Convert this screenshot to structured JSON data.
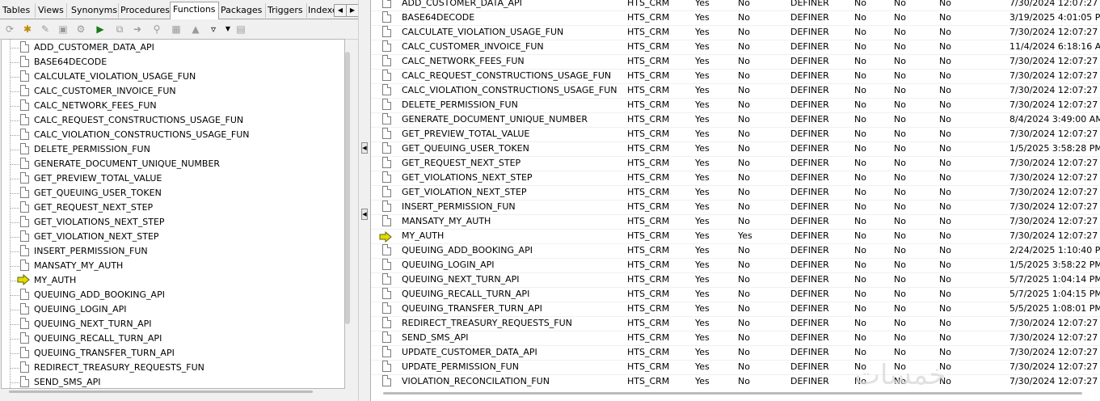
{
  "tabs": {
    "items": [
      "Tables",
      "Views",
      "Synonyms",
      "Procedures",
      "Functions",
      "Packages",
      "Triggers",
      "Indexe"
    ],
    "active": "Functions"
  },
  "toolbar": {
    "icons": [
      "refresh-icon",
      "new-object-icon",
      "edit-icon",
      "save-icon",
      "compile-icon",
      "debug-icon",
      "copy-icon",
      "export-icon",
      "find-icon",
      "chart-icon",
      "filter-icon"
    ]
  },
  "functions": [
    "ADD_CUSTOMER_DATA_API",
    "BASE64DECODE",
    "CALCULATE_VIOLATION_USAGE_FUN",
    "CALC_CUSTOMER_INVOICE_FUN",
    "CALC_NETWORK_FEES_FUN",
    "CALC_REQUEST_CONSTRUCTIONS_USAGE_FUN",
    "CALC_VIOLATION_CONSTRUCTIONS_USAGE_FUN",
    "DELETE_PERMISSION_FUN",
    "GENERATE_DOCUMENT_UNIQUE_NUMBER",
    "GET_PREVIEW_TOTAL_VALUE",
    "GET_QUEUING_USER_TOKEN",
    "GET_REQUEST_NEXT_STEP",
    "GET_VIOLATIONS_NEXT_STEP",
    "GET_VIOLATION_NEXT_STEP",
    "INSERT_PERMISSION_FUN",
    "MANSATY_MY_AUTH",
    "MY_AUTH",
    "QUEUING_ADD_BOOKING_API",
    "QUEUING_LOGIN_API",
    "QUEUING_NEXT_TURN_API",
    "QUEUING_RECALL_TURN_API",
    "QUEUING_TRANSFER_TURN_API",
    "REDIRECT_TREASURY_REQUESTS_FUN",
    "SEND_SMS_API"
  ],
  "selected_function": "MY_AUTH",
  "grid": {
    "rows": [
      {
        "name": "ADD_CUSTOMER_DATA_API",
        "owner": "HTS_CRM",
        "valid": "Yes",
        "debug": "No",
        "authid": "DEFINER",
        "c1": "No",
        "c2": "No",
        "c3": "No",
        "modified": "7/30/2024 12:07:27 P"
      },
      {
        "name": "BASE64DECODE",
        "owner": "HTS_CRM",
        "valid": "Yes",
        "debug": "No",
        "authid": "DEFINER",
        "c1": "No",
        "c2": "No",
        "c3": "No",
        "modified": "3/19/2025 4:01:05 PM"
      },
      {
        "name": "CALCULATE_VIOLATION_USAGE_FUN",
        "owner": "HTS_CRM",
        "valid": "Yes",
        "debug": "No",
        "authid": "DEFINER",
        "c1": "No",
        "c2": "No",
        "c3": "No",
        "modified": "7/30/2024 12:07:27 P"
      },
      {
        "name": "CALC_CUSTOMER_INVOICE_FUN",
        "owner": "HTS_CRM",
        "valid": "Yes",
        "debug": "No",
        "authid": "DEFINER",
        "c1": "No",
        "c2": "No",
        "c3": "No",
        "modified": "11/4/2024 6:18:16 AM"
      },
      {
        "name": "CALC_NETWORK_FEES_FUN",
        "owner": "HTS_CRM",
        "valid": "Yes",
        "debug": "No",
        "authid": "DEFINER",
        "c1": "No",
        "c2": "No",
        "c3": "No",
        "modified": "7/30/2024 12:07:27 P"
      },
      {
        "name": "CALC_REQUEST_CONSTRUCTIONS_USAGE_FUN",
        "owner": "HTS_CRM",
        "valid": "Yes",
        "debug": "No",
        "authid": "DEFINER",
        "c1": "No",
        "c2": "No",
        "c3": "No",
        "modified": "7/30/2024 12:07:27 P"
      },
      {
        "name": "CALC_VIOLATION_CONSTRUCTIONS_USAGE_FUN",
        "owner": "HTS_CRM",
        "valid": "Yes",
        "debug": "No",
        "authid": "DEFINER",
        "c1": "No",
        "c2": "No",
        "c3": "No",
        "modified": "7/30/2024 12:07:27 P"
      },
      {
        "name": "DELETE_PERMISSION_FUN",
        "owner": "HTS_CRM",
        "valid": "Yes",
        "debug": "No",
        "authid": "DEFINER",
        "c1": "No",
        "c2": "No",
        "c3": "No",
        "modified": "7/30/2024 12:07:27 P"
      },
      {
        "name": "GENERATE_DOCUMENT_UNIQUE_NUMBER",
        "owner": "HTS_CRM",
        "valid": "Yes",
        "debug": "No",
        "authid": "DEFINER",
        "c1": "No",
        "c2": "No",
        "c3": "No",
        "modified": "8/4/2024 3:49:00 AM"
      },
      {
        "name": "GET_PREVIEW_TOTAL_VALUE",
        "owner": "HTS_CRM",
        "valid": "Yes",
        "debug": "No",
        "authid": "DEFINER",
        "c1": "No",
        "c2": "No",
        "c3": "No",
        "modified": "7/30/2024 12:07:27 P"
      },
      {
        "name": "GET_QUEUING_USER_TOKEN",
        "owner": "HTS_CRM",
        "valid": "Yes",
        "debug": "No",
        "authid": "DEFINER",
        "c1": "No",
        "c2": "No",
        "c3": "No",
        "modified": "1/5/2025 3:58:28 PM"
      },
      {
        "name": "GET_REQUEST_NEXT_STEP",
        "owner": "HTS_CRM",
        "valid": "Yes",
        "debug": "No",
        "authid": "DEFINER",
        "c1": "No",
        "c2": "No",
        "c3": "No",
        "modified": "7/30/2024 12:07:27 P"
      },
      {
        "name": "GET_VIOLATIONS_NEXT_STEP",
        "owner": "HTS_CRM",
        "valid": "Yes",
        "debug": "No",
        "authid": "DEFINER",
        "c1": "No",
        "c2": "No",
        "c3": "No",
        "modified": "7/30/2024 12:07:27 P"
      },
      {
        "name": "GET_VIOLATION_NEXT_STEP",
        "owner": "HTS_CRM",
        "valid": "Yes",
        "debug": "No",
        "authid": "DEFINER",
        "c1": "No",
        "c2": "No",
        "c3": "No",
        "modified": "7/30/2024 12:07:27 P"
      },
      {
        "name": "INSERT_PERMISSION_FUN",
        "owner": "HTS_CRM",
        "valid": "Yes",
        "debug": "No",
        "authid": "DEFINER",
        "c1": "No",
        "c2": "No",
        "c3": "No",
        "modified": "7/30/2024 12:07:27 P"
      },
      {
        "name": "MANSATY_MY_AUTH",
        "owner": "HTS_CRM",
        "valid": "Yes",
        "debug": "No",
        "authid": "DEFINER",
        "c1": "No",
        "c2": "No",
        "c3": "No",
        "modified": "7/30/2024 12:07:27 P"
      },
      {
        "name": "MY_AUTH",
        "owner": "HTS_CRM",
        "valid": "Yes",
        "debug": "Yes",
        "authid": "DEFINER",
        "c1": "No",
        "c2": "No",
        "c3": "No",
        "modified": "7/30/2024 12:07:27 P"
      },
      {
        "name": "QUEUING_ADD_BOOKING_API",
        "owner": "HTS_CRM",
        "valid": "Yes",
        "debug": "No",
        "authid": "DEFINER",
        "c1": "No",
        "c2": "No",
        "c3": "No",
        "modified": "2/24/2025 1:10:40 PM"
      },
      {
        "name": "QUEUING_LOGIN_API",
        "owner": "HTS_CRM",
        "valid": "Yes",
        "debug": "No",
        "authid": "DEFINER",
        "c1": "No",
        "c2": "No",
        "c3": "No",
        "modified": "1/5/2025 3:58:22 PM"
      },
      {
        "name": "QUEUING_NEXT_TURN_API",
        "owner": "HTS_CRM",
        "valid": "Yes",
        "debug": "No",
        "authid": "DEFINER",
        "c1": "No",
        "c2": "No",
        "c3": "No",
        "modified": "5/7/2025 1:04:14 PM"
      },
      {
        "name": "QUEUING_RECALL_TURN_API",
        "owner": "HTS_CRM",
        "valid": "Yes",
        "debug": "No",
        "authid": "DEFINER",
        "c1": "No",
        "c2": "No",
        "c3": "No",
        "modified": "5/7/2025 1:04:15 PM"
      },
      {
        "name": "QUEUING_TRANSFER_TURN_API",
        "owner": "HTS_CRM",
        "valid": "Yes",
        "debug": "No",
        "authid": "DEFINER",
        "c1": "No",
        "c2": "No",
        "c3": "No",
        "modified": "5/5/2025 1:08:01 PM"
      },
      {
        "name": "REDIRECT_TREASURY_REQUESTS_FUN",
        "owner": "HTS_CRM",
        "valid": "Yes",
        "debug": "No",
        "authid": "DEFINER",
        "c1": "No",
        "c2": "No",
        "c3": "No",
        "modified": "7/30/2024 12:07:27 P"
      },
      {
        "name": "SEND_SMS_API",
        "owner": "HTS_CRM",
        "valid": "Yes",
        "debug": "No",
        "authid": "DEFINER",
        "c1": "No",
        "c2": "No",
        "c3": "No",
        "modified": "7/30/2024 12:07:27 P"
      },
      {
        "name": "UPDATE_CUSTOMER_DATA_API",
        "owner": "HTS_CRM",
        "valid": "Yes",
        "debug": "No",
        "authid": "DEFINER",
        "c1": "No",
        "c2": "No",
        "c3": "No",
        "modified": "7/30/2024 12:07:27 P"
      },
      {
        "name": "UPDATE_PERMISSION_FUN",
        "owner": "HTS_CRM",
        "valid": "Yes",
        "debug": "No",
        "authid": "DEFINER",
        "c1": "No",
        "c2": "No",
        "c3": "No",
        "modified": "7/30/2024 12:07:27 P"
      },
      {
        "name": "VIOLATION_RECONCILATION_FUN",
        "owner": "HTS_CRM",
        "valid": "Yes",
        "debug": "No",
        "authid": "DEFINER",
        "c1": "No",
        "c2": "No",
        "c3": "No",
        "modified": "7/30/2024 12:07:27 P"
      }
    ]
  },
  "watermark": "خمسات"
}
